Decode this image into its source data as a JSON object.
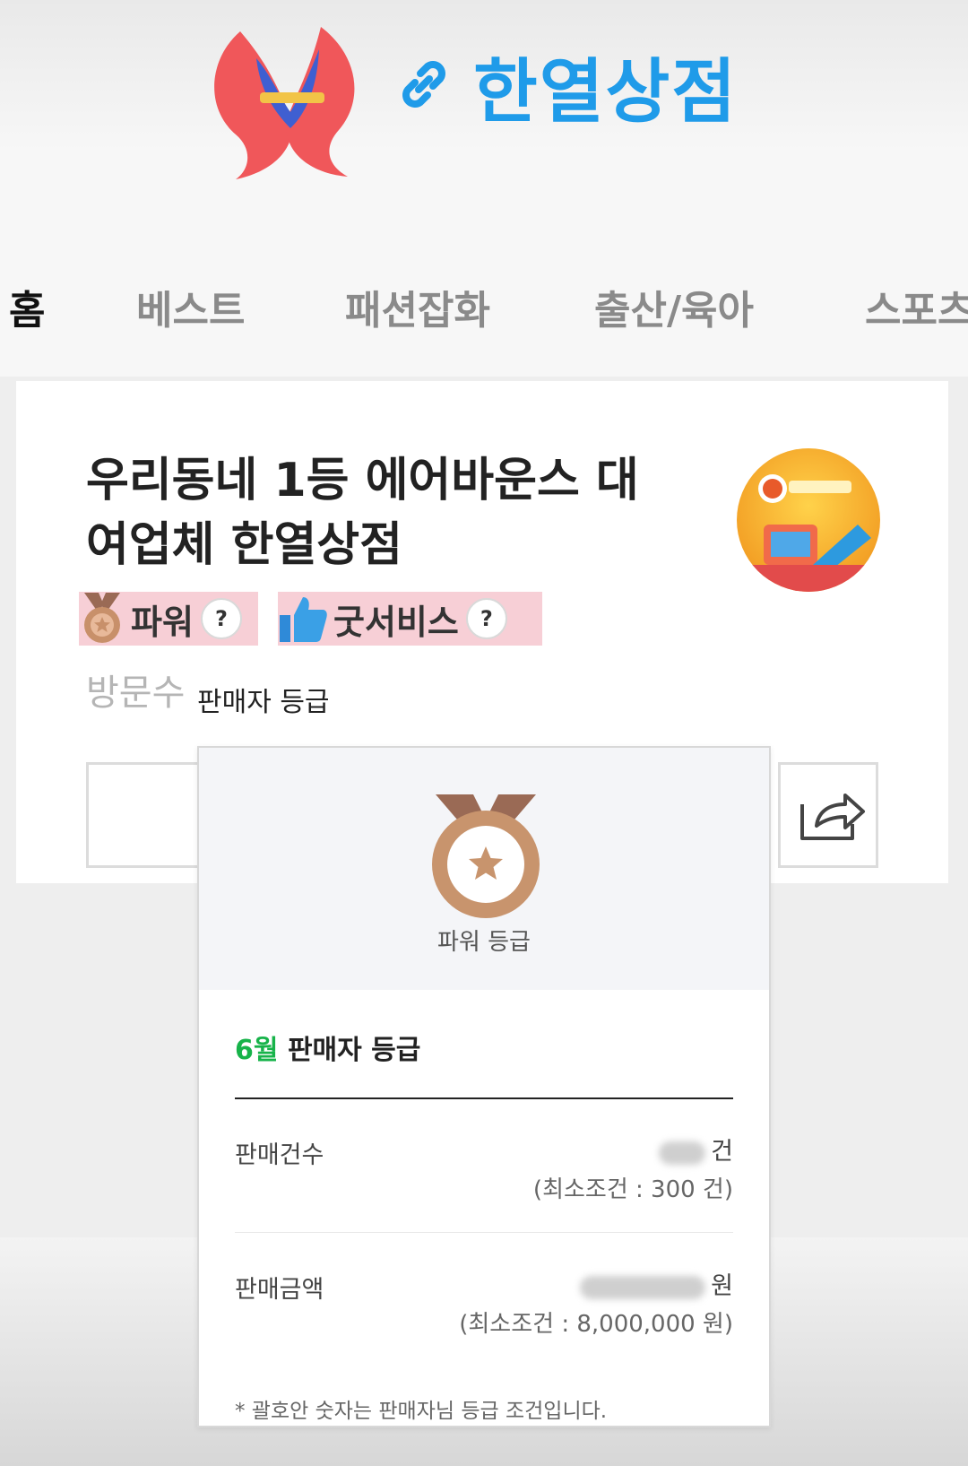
{
  "header": {
    "store_name": "한열상점",
    "logo_icon": "hs-flame-logo",
    "link_icon": "link-icon",
    "brand_color": "#1f9be9"
  },
  "nav": {
    "tabs": [
      {
        "label": "홈",
        "active": true
      },
      {
        "label": "베스트",
        "active": false
      },
      {
        "label": "패션잡화",
        "active": false
      },
      {
        "label": "출산/육아",
        "active": false
      },
      {
        "label": "스포츠",
        "active": false
      }
    ]
  },
  "store": {
    "title_line1": "우리동네 1등 에어바운스 대",
    "title_line2": "여업체 한열상점",
    "badge_power": "파워",
    "badge_goodservice": "굿서비스",
    "help_mark": "?",
    "visitors_label": "방문수",
    "badge_highlight_color": "#f7cfd6"
  },
  "tooltip": {
    "label": "판매자 등급"
  },
  "popover": {
    "grade_label": "파워 등급",
    "month": "6월",
    "month_suffix": "판매자 등급",
    "month_color": "#17b34a",
    "sales_count_label": "판매건수",
    "sales_count_unit": "건",
    "sales_count_min": "(최소조건 : 300 건)",
    "sales_amount_label": "판매금액",
    "sales_amount_unit": "원",
    "sales_amount_min": "(최소조건 : 8,000,000 원)",
    "footnote": "* 괄호안 숫자는 판매자님 등급 조건입니다."
  }
}
